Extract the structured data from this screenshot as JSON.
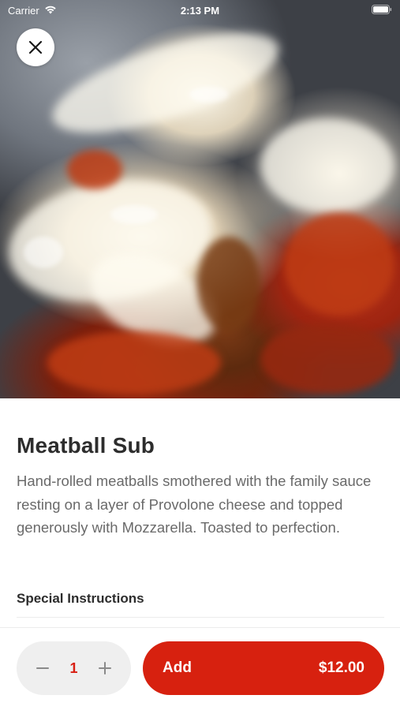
{
  "status_bar": {
    "carrier": "Carrier",
    "time": "2:13 PM",
    "wifi_icon": "wifi-icon",
    "battery_icon": "battery-icon"
  },
  "hero": {
    "image_subject": "meatball sub photo",
    "close_icon": "close-icon"
  },
  "item": {
    "title": "Meatball Sub",
    "description": "Hand-rolled meatballs smothered with the family sauce resting on a layer of Provolone cheese and topped generously with Mozzarella. Toasted to perfection."
  },
  "special_instructions": {
    "label": "Special Instructions"
  },
  "footer": {
    "quantity": "1",
    "minus_icon": "minus-icon",
    "plus_icon": "plus-icon",
    "add_label": "Add",
    "price": "$12.00"
  },
  "colors": {
    "accent": "#d7210f",
    "quantity_text": "#d81e12",
    "stepper_bg": "#efefef",
    "title_text": "#2d2d2d",
    "body_text": "#6a6a6a"
  }
}
